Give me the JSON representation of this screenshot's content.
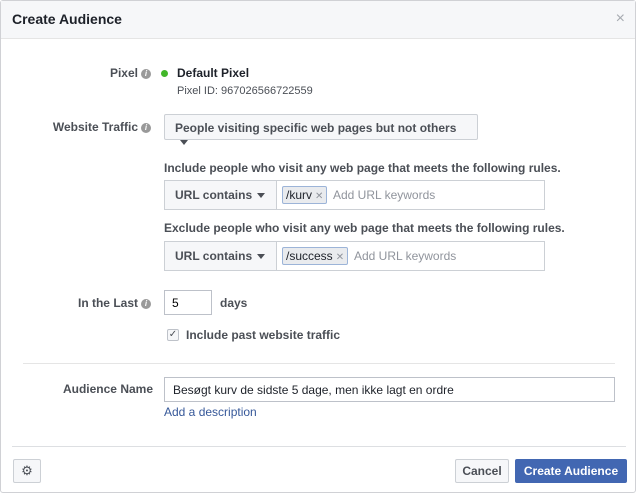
{
  "dialog": {
    "title": "Create Audience",
    "close_glyph": "×"
  },
  "pixel": {
    "label": "Pixel",
    "name": "Default Pixel",
    "id_text": "Pixel ID: 967026566722559",
    "status_color": "#42b72a"
  },
  "website_traffic": {
    "label": "Website Traffic",
    "selected": "People visiting specific web pages but not others"
  },
  "include": {
    "text": "Include people who visit any web page that meets the following rules.",
    "operator": "URL contains",
    "token": "/kurv",
    "placeholder": "Add URL keywords"
  },
  "exclude": {
    "text": "Exclude people who visit any web page that meets the following rules.",
    "operator": "URL contains",
    "token": "/success",
    "placeholder": "Add URL keywords"
  },
  "in_the_last": {
    "label": "In the Last",
    "value": "5",
    "unit": "days"
  },
  "past_traffic": {
    "label": "Include past website traffic",
    "checked": true
  },
  "audience_name": {
    "label": "Audience Name",
    "value": "Besøgt kurv de sidste 5 dage, men ikke lagt en ordre",
    "add_description": "Add a description"
  },
  "footer": {
    "cancel": "Cancel",
    "create": "Create Audience",
    "accent": "#4267b2"
  },
  "icons": {
    "info": "info-icon",
    "gear": "gear-icon",
    "close": "close-icon",
    "caret": "caret-down-icon",
    "check": "checkmark-icon"
  }
}
